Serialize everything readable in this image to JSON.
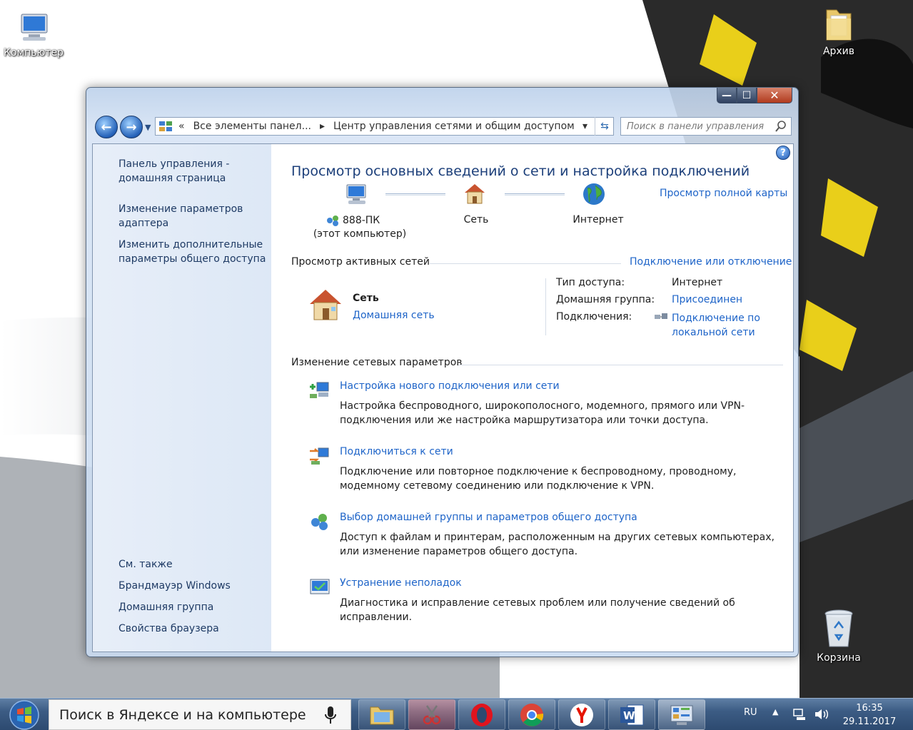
{
  "desktop": {
    "icons": [
      {
        "label": "Компьютер"
      },
      {
        "label": "Архив"
      },
      {
        "label": "Корзина"
      }
    ]
  },
  "window": {
    "caption_buttons": {
      "minimize": "—",
      "maximize": "☐",
      "close": "✕"
    },
    "nav": {
      "address": {
        "overflow": "«",
        "seg1": "Все элементы панел...",
        "separator": "▸",
        "seg2": "Центр управления сетями и общим доступом",
        "dropdown": "▾"
      },
      "search_placeholder": "Поиск в панели управления"
    },
    "sidebar": {
      "items": [
        {
          "label": "Панель управления - домашняя страница"
        },
        {
          "label": "Изменение параметров адаптера"
        },
        {
          "label": "Изменить дополнительные параметры общего доступа"
        }
      ],
      "see_also_title": "См. также",
      "see_also": [
        {
          "label": "Брандмауэр Windows"
        },
        {
          "label": "Домашняя группа"
        },
        {
          "label": "Свойства браузера"
        }
      ]
    },
    "main": {
      "title": "Просмотр основных сведений о сети и настройка подключений",
      "full_map_link": "Просмотр полной карты",
      "map": {
        "computer_name": "888-ПК",
        "computer_sub": "(этот компьютер)",
        "network": "Сеть",
        "internet": "Интернет"
      },
      "active_title": "Просмотр активных сетей",
      "connect_link": "Подключение или отключение",
      "active_network": {
        "name": "Сеть",
        "type_link": "Домашняя сеть",
        "access_label": "Тип доступа:",
        "access_value": "Интернет",
        "homegroup_label": "Домашняя группа:",
        "homegroup_value": "Присоединен",
        "connections_label": "Подключения:",
        "connections_value": "Подключение по локальной сети"
      },
      "change_title": "Изменение сетевых параметров",
      "tasks": [
        {
          "title": "Настройка нового подключения или сети",
          "desc": "Настройка беспроводного, широкополосного, модемного, прямого или VPN-подключения или же настройка маршрутизатора или точки доступа."
        },
        {
          "title": "Подключиться к сети",
          "desc": "Подключение или повторное подключение к беспроводному, проводному, модемному сетевому соединению или подключение к VPN."
        },
        {
          "title": "Выбор домашней группы и параметров общего доступа",
          "desc": "Доступ к файлам и принтерам, расположенным на других сетевых компьютерах, или изменение параметров общего доступа."
        },
        {
          "title": "Устранение неполадок",
          "desc": "Диагностика и исправление сетевых проблем или получение сведений об исправлении."
        }
      ]
    }
  },
  "taskbar": {
    "search_text": "Поиск в Яндексе и на компьютере",
    "lang": "RU",
    "time": "16:35",
    "date": "29.11.2017"
  }
}
